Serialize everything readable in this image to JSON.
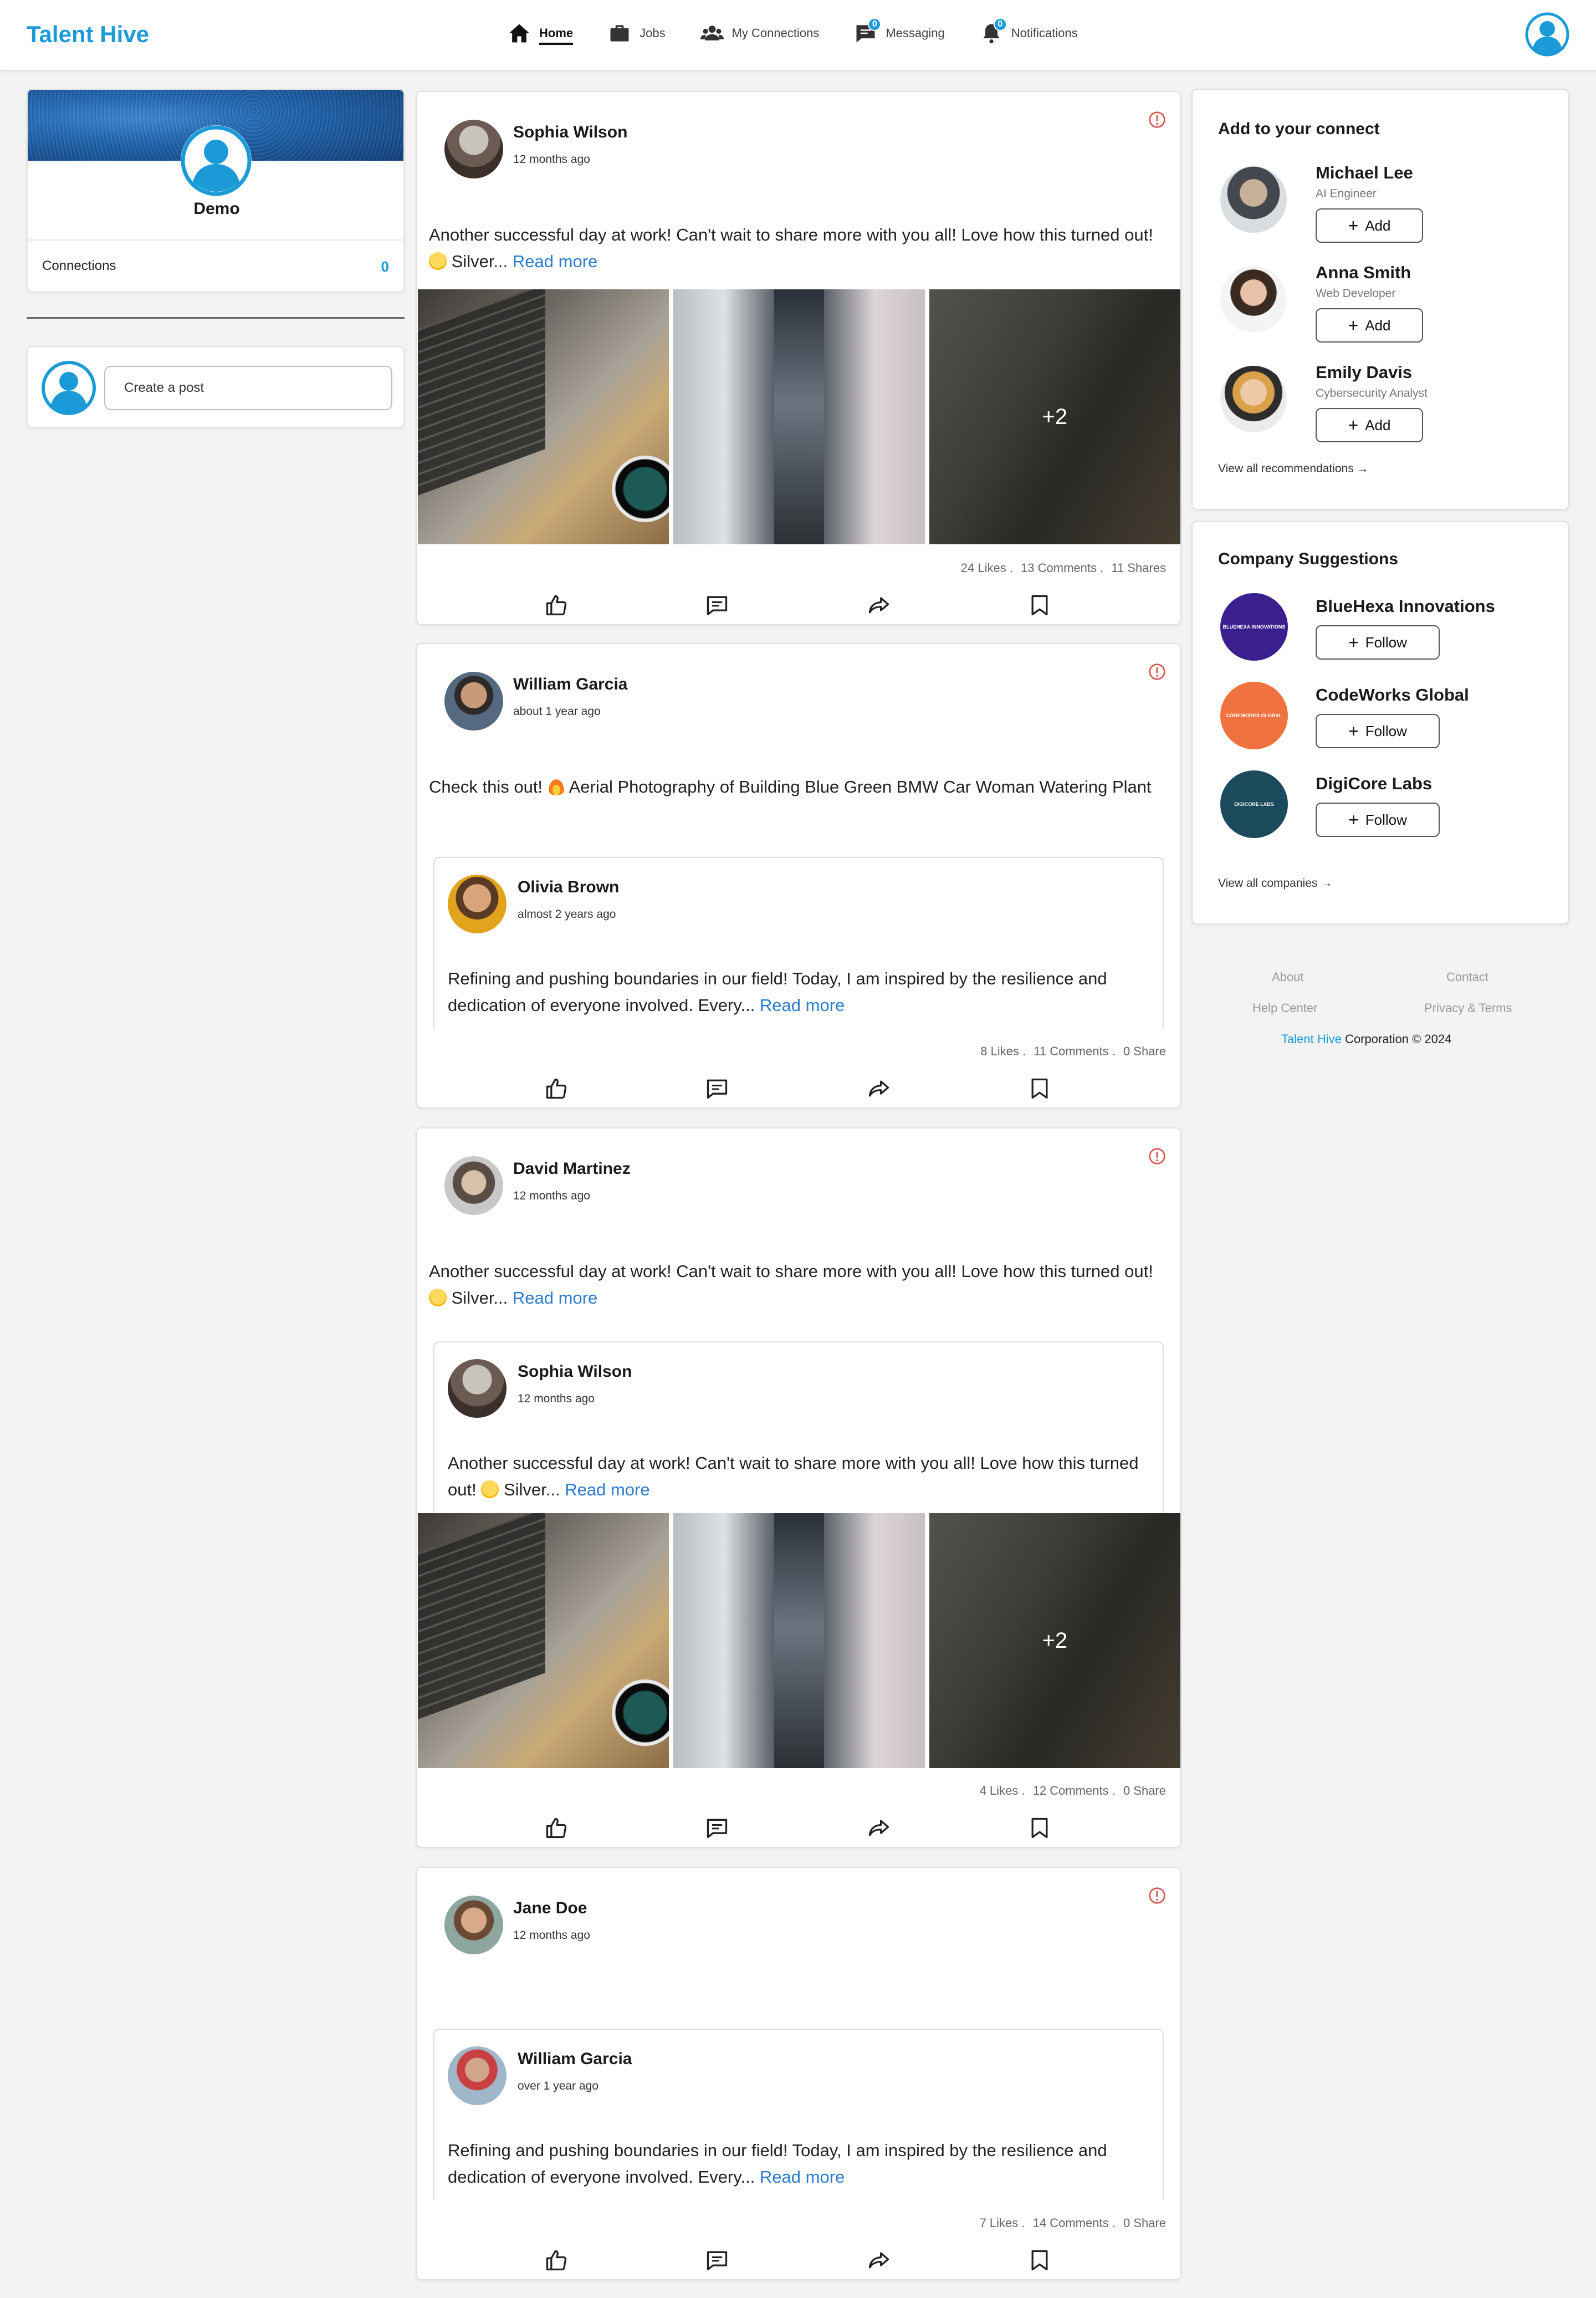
{
  "brand": "Talent Hive",
  "nav": {
    "home": "Home",
    "jobs": "Jobs",
    "connections": "My Connections",
    "messaging": "Messaging",
    "messaging_badge": "0",
    "notifications": "Notifications",
    "notifications_badge": "0"
  },
  "profile": {
    "name": "Demo",
    "connections_label": "Connections",
    "connections_count": "0"
  },
  "create_post": {
    "placeholder": "Create a post"
  },
  "posts": [
    {
      "author": "Sophia Wilson",
      "time": "12 months ago",
      "text": "Another successful day at work! Can't wait to share more with you all! Love how this turned out!",
      "text_tail": "Silver...",
      "read_more": "Read more",
      "images": [
        "laptop-on-desk",
        "building-corridor",
        "office-workers"
      ],
      "more_count": "+2",
      "stats": {
        "likes": "24 Likes",
        "comments": "13 Comments",
        "shares": "11 Shares"
      }
    },
    {
      "author": "William Garcia",
      "time": "about 1 year ago",
      "text": "Check this out!",
      "text_tail": "Aerial Photography of Building Blue Green BMW Car Woman Watering Plant",
      "shared": {
        "author": "Olivia Brown",
        "time": "almost 2 years ago",
        "text": "Refining and pushing boundaries in our field! Today, I am inspired by the resilience and dedication of everyone involved. Every...",
        "read_more": "Read more"
      },
      "stats": {
        "likes": "8 Likes",
        "comments": "11 Comments",
        "shares": "0 Share"
      }
    },
    {
      "author": "David Martinez",
      "time": "12 months ago",
      "text": "Another successful day at work! Can't wait to share more with you all! Love how this turned out!",
      "text_tail": "Silver...",
      "read_more": "Read more",
      "shared": {
        "author": "Sophia Wilson",
        "time": "12 months ago",
        "text": "Another successful day at work! Can't wait to share more with you all! Love how this turned out!",
        "text_tail": "Silver...",
        "read_more": "Read more"
      },
      "images": [
        "laptop-on-desk",
        "building-corridor",
        "office-workers"
      ],
      "more_count": "+2",
      "stats": {
        "likes": "4 Likes",
        "comments": "12 Comments",
        "shares": "0 Share"
      }
    },
    {
      "author": "Jane Doe",
      "time": "12 months ago",
      "shared": {
        "author": "William Garcia",
        "time": "over 1 year ago",
        "text": "Refining and pushing boundaries in our field! Today, I am inspired by the resilience and dedication of everyone involved. Every...",
        "read_more": "Read more"
      },
      "stats": {
        "likes": "7 Likes",
        "comments": "14 Comments",
        "shares": "0 Share"
      }
    }
  ],
  "suggestions": {
    "title": "Add to your connect",
    "people": [
      {
        "name": "Michael Lee",
        "role": "AI Engineer",
        "button": "Add"
      },
      {
        "name": "Anna Smith",
        "role": "Web Developer",
        "button": "Add"
      },
      {
        "name": "Emily Davis",
        "role": "Cybersecurity Analyst",
        "button": "Add"
      }
    ],
    "view_all": "View all recommendations"
  },
  "companies": {
    "title": "Company Suggestions",
    "items": [
      {
        "name": "BlueHexa Innovations",
        "logo_text": "BLUEHEXA INNOVATIONS",
        "color": "#3b1f8f",
        "button": "Follow"
      },
      {
        "name": "CodeWorks Global",
        "logo_text": "CODEWORKS GLOBAL",
        "color": "#f0733f",
        "button": "Follow"
      },
      {
        "name": "DigiCore Labs",
        "logo_text": "DIGICORE LABS",
        "color": "#1b4a5c",
        "button": "Follow"
      }
    ],
    "view_all": "View all companies"
  },
  "footer": {
    "about": "About",
    "contact": "Contact",
    "help": "Help Center",
    "privacy": "Privacy & Terms",
    "brand": "Talent Hive",
    "copyright": "Corporation © 2024"
  },
  "colors": {
    "accent": "#1a9bd7",
    "link": "#2b7cd0",
    "report": "#d9534f"
  }
}
